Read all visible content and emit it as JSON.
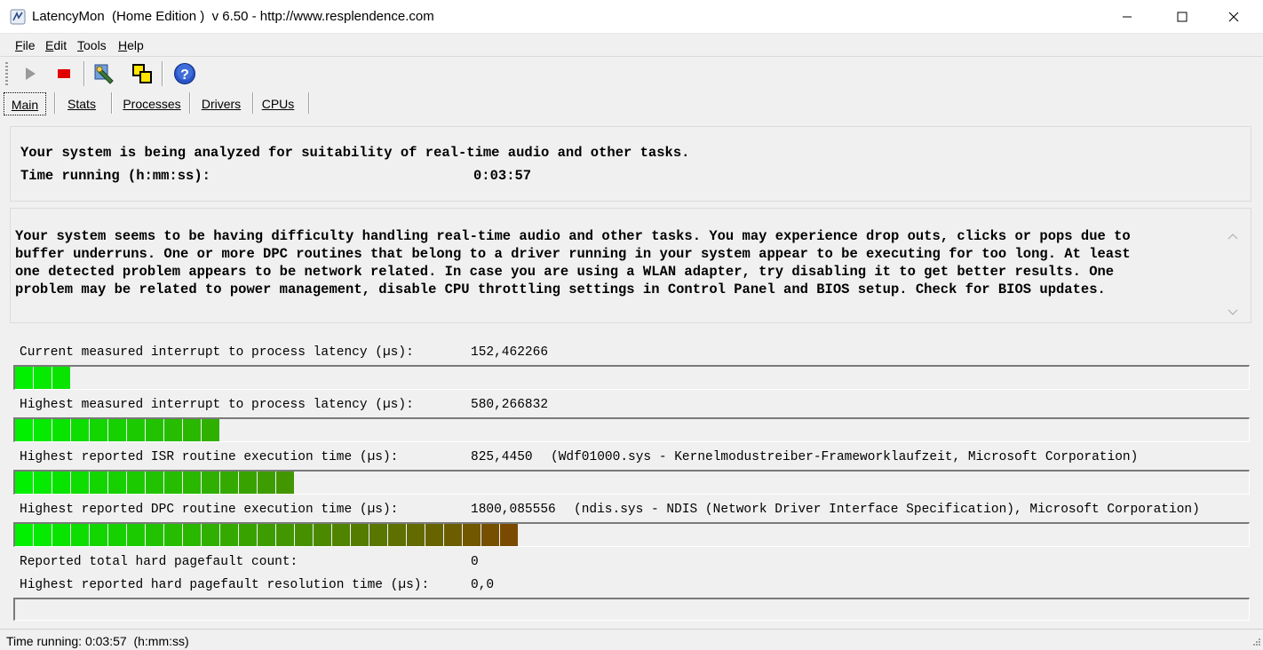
{
  "window": {
    "title": "LatencyMon  (Home Edition )  v 6.50 - http://www.resplendence.com",
    "icon": "latencymon-app-icon",
    "controls": [
      "minimize-icon",
      "maximize-icon",
      "close-icon"
    ]
  },
  "menu": {
    "items": [
      {
        "label": "File",
        "mnemonic": "F",
        "rest": "ile"
      },
      {
        "label": "Edit",
        "mnemonic": "E",
        "rest": "dit"
      },
      {
        "label": "Tools",
        "mnemonic": "T",
        "rest": "ools"
      },
      {
        "label": "Help",
        "mnemonic": "H",
        "rest": "elp"
      }
    ]
  },
  "toolbar": {
    "buttons": [
      {
        "name": "play-icon",
        "enabled": false
      },
      {
        "name": "stop-icon",
        "enabled": true,
        "color": "#e00000"
      },
      {
        "name": "driver-wizard-icon",
        "enabled": true
      },
      {
        "name": "windows-icon",
        "enabled": true
      },
      {
        "name": "help-icon",
        "enabled": true,
        "color": "#2a55c8"
      }
    ]
  },
  "tabs": [
    {
      "label": "Main",
      "active": true
    },
    {
      "label": "Stats",
      "active": false
    },
    {
      "label": "Processes",
      "active": false
    },
    {
      "label": "Drivers",
      "active": false
    },
    {
      "label": "CPUs",
      "active": false
    }
  ],
  "status_panel": {
    "line1": "Your system is being analyzed for suitability of real-time audio and other tasks.",
    "time_label": "Time running (h:mm:ss):",
    "time_value": "0:03:57"
  },
  "conclusion_panel": {
    "text": "Your system seems to be having difficulty handling real-time audio and other tasks. You may experience drop outs, clicks or pops due to\nbuffer underruns. One or more DPC routines that belong to a driver running in your system appear to be executing for too long. At least\none detected problem appears to be network related. In case you are using a WLAN adapter, try disabling it to get better results. One\nproblem may be related to power management, disable CPU throttling settings in Control Panel and BIOS setup. Check for BIOS updates."
  },
  "metrics": [
    {
      "label": "Current measured interrupt to process latency (µs):",
      "value": "152,462266",
      "extra": "",
      "segments": 3
    },
    {
      "label": "Highest measured interrupt to process latency (µs):",
      "value": "580,266832",
      "extra": "",
      "segments": 11
    },
    {
      "label": "Highest reported ISR routine execution time (µs):",
      "value": "825,4450",
      "extra": "(Wdf01000.sys - Kernelmodustreiber-Frameworklaufzeit, Microsoft Corporation)",
      "segments": 15
    },
    {
      "label": "Highest reported DPC routine execution time (µs):",
      "value": "1800,085556",
      "extra": "(ndis.sys - NDIS (Network Driver Interface Specification), Microsoft Corporation)",
      "segments": 27
    },
    {
      "label": "Reported total hard pagefault count:",
      "value": "0",
      "extra": ""
    },
    {
      "label": "Highest reported hard pagefault resolution time (µs):",
      "value": "0,0",
      "extra": "",
      "segments": 0
    }
  ],
  "colors": {
    "bar_start": "#00f000",
    "bar_end": "#7a4a00"
  },
  "statusbar": {
    "text": "Time running: 0:03:57  (h:mm:ss)"
  }
}
